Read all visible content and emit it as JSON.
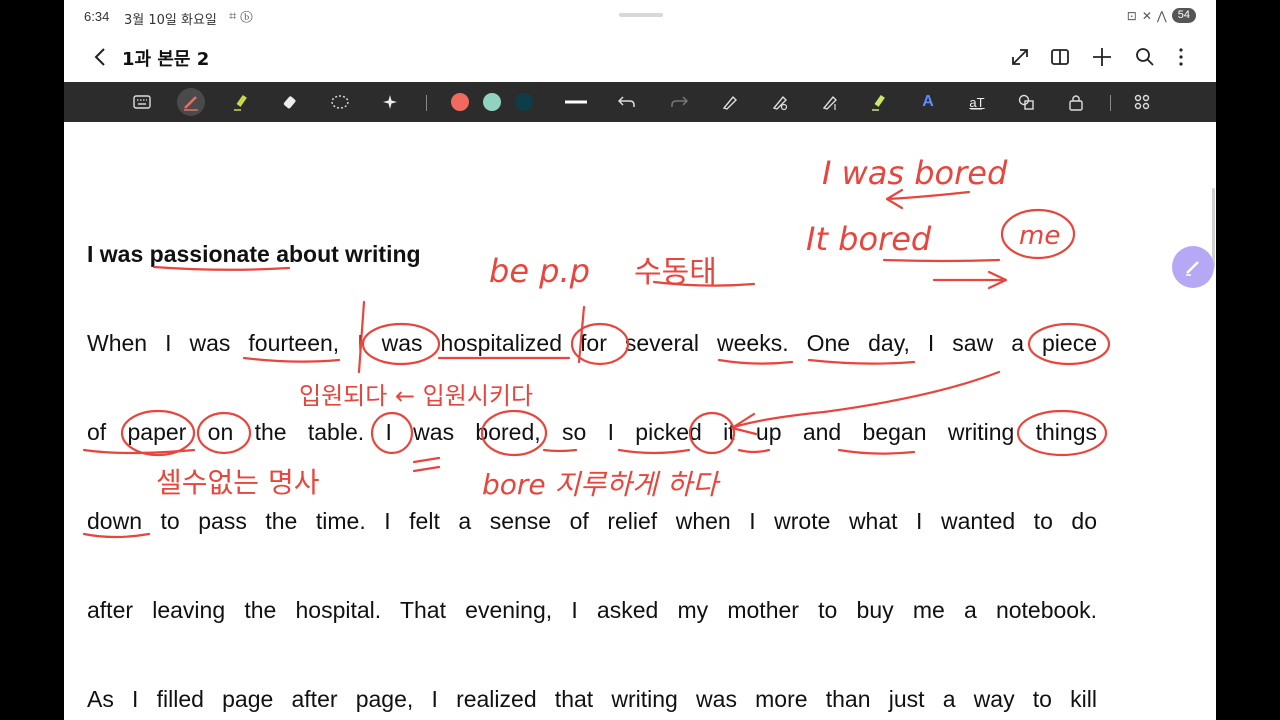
{
  "status": {
    "time": "6:34",
    "date": "3월 10일 화요일",
    "battery": "54"
  },
  "header": {
    "title": "1과 본문 2"
  },
  "toolbar": {
    "colors": [
      "#f26a5e",
      "#8fd3c0",
      "#0e3d4a"
    ],
    "active_tool": "pen"
  },
  "document": {
    "heading": "I was passionate about writing",
    "lines": [
      "When I was fourteen, I was hospitalized for several weeks. One day, I saw a piece",
      "of paper on the table. I was bored, so I picked it up and began writing things",
      "down to pass the time. I felt a sense of relief when I wrote what I wanted to do",
      "after leaving the hospital. That evening, I asked my mother to buy me a notebook.",
      "As I filled page after page, I realized that writing was more than just a way to kill"
    ]
  },
  "annotations": {
    "note_bored_1": "I was bored",
    "note_bored_2": "It bored",
    "note_me": "me",
    "note_bepp": "be p.p",
    "note_passive": "수동태",
    "note_hospitalized": "입원되다 ← 입원시키다",
    "note_uncountable": "셀수없는 명사",
    "note_bore": "bore 지루하게 하다"
  }
}
